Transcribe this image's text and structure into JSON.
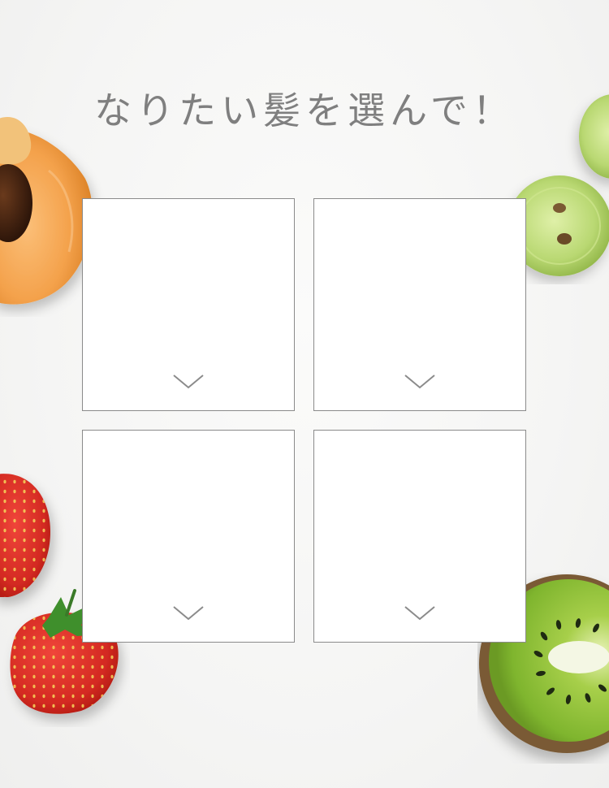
{
  "title": "なりたい髪を選んで！",
  "options": [
    {
      "icon": "chevron-down-icon"
    },
    {
      "icon": "chevron-down-icon"
    },
    {
      "icon": "chevron-down-icon"
    },
    {
      "icon": "chevron-down-icon"
    }
  ],
  "decorations": [
    "apricot-half",
    "green-grapes",
    "strawberries",
    "kiwi-half"
  ],
  "colors": {
    "background": "#f6f6f5",
    "title_text": "#7f7f7f",
    "card_border": "#8b8b8b",
    "card_fill": "#ffffff"
  }
}
